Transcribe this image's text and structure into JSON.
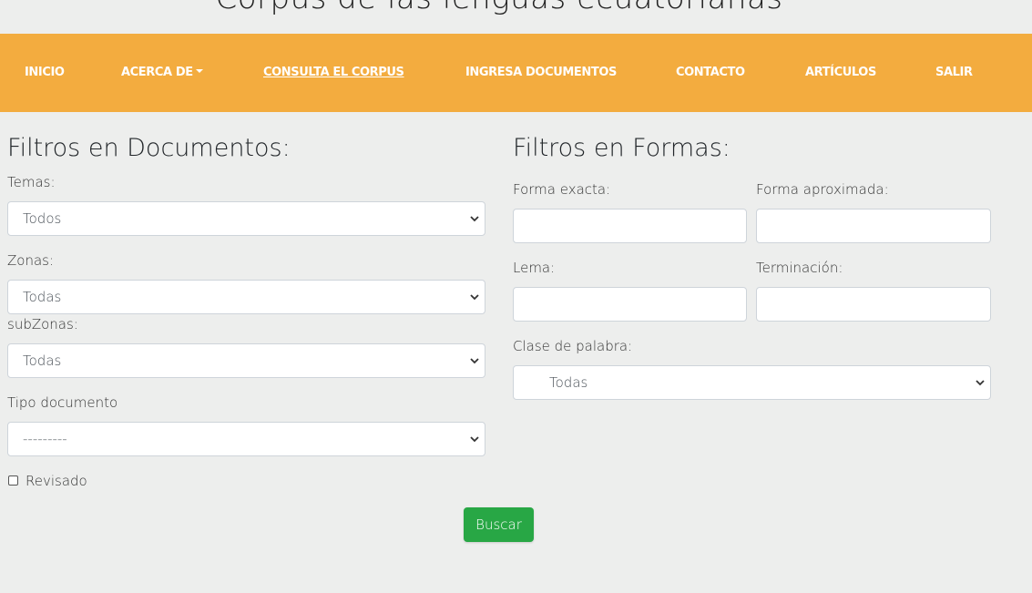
{
  "header": {
    "title": "Corpus de las lenguas ecuatorianas"
  },
  "nav": {
    "items": [
      {
        "label": "INICIO"
      },
      {
        "label": "ACERCA DE"
      },
      {
        "label": "CONSULTA EL CORPUS"
      },
      {
        "label": "INGRESA DOCUMENTOS"
      },
      {
        "label": "CONTACTO"
      },
      {
        "label": "ARTÍCULOS"
      },
      {
        "label": "SALIR"
      }
    ],
    "active": "CONSULTA EL CORPUS"
  },
  "documentos": {
    "title": "Filtros en Documentos:",
    "temas_label": "Temas:",
    "temas_value": "Todos",
    "zonas_label": "Zonas:",
    "zonas_value": "Todas",
    "subzonas_label": "subZonas:",
    "subzonas_value": "Todas",
    "tipo_label": "Tipo documento",
    "tipo_value": "---------",
    "revisado_label": "Revisado",
    "revisado_checked": false
  },
  "formas": {
    "title": "Filtros en Formas:",
    "forma_exacta_label": "Forma exacta:",
    "forma_exacta_value": "",
    "forma_aprox_label": "Forma aproximada:",
    "forma_aprox_value": "",
    "lema_label": "Lema:",
    "lema_value": "",
    "terminacion_label": "Terminación:",
    "terminacion_value": "",
    "clase_label": "Clase de palabra:",
    "clase_value": "Todas"
  },
  "actions": {
    "search_label": "Buscar"
  },
  "colors": {
    "navbar": "#f3ac3f",
    "button": "#28a745",
    "background": "#edeeed"
  },
  "icons": {
    "select_arrow": "chevron-down-icon"
  }
}
